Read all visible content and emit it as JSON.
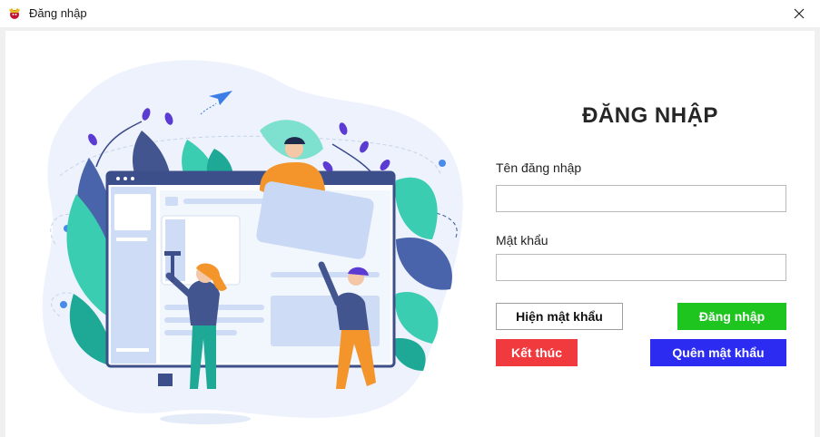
{
  "window": {
    "title": "Đăng nhập",
    "icon": "app-logo-icon",
    "close_icon": "close-icon"
  },
  "form": {
    "heading": "ĐĂNG NHẬP",
    "username_label": "Tên đăng nhập",
    "username_value": "",
    "password_label": "Mật khẩu",
    "password_value": ""
  },
  "buttons": {
    "show_password": "Hiện mật khẩu",
    "login": "Đăng nhập",
    "exit": "Kết thúc",
    "forgot_password": "Quên mật khẩu"
  },
  "colors": {
    "login": "#1ec51e",
    "exit": "#f03a3e",
    "forgot": "#2b2bf2"
  }
}
